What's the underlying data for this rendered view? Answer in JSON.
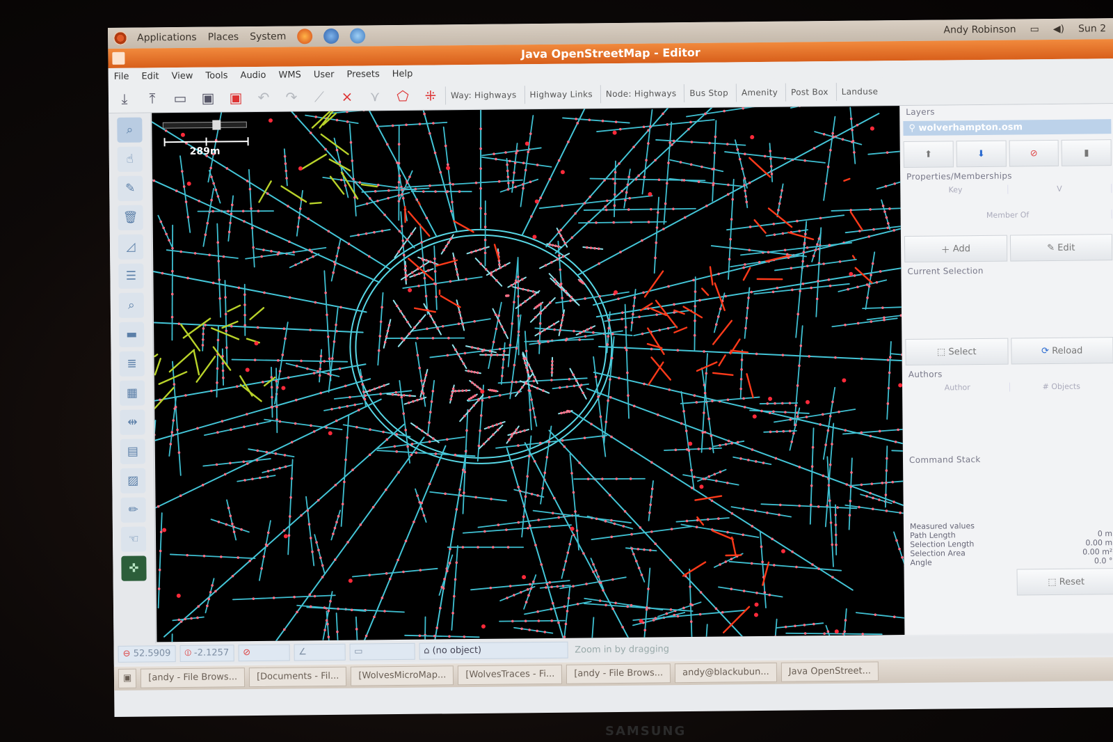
{
  "system_panel": {
    "menus": [
      "Applications",
      "Places",
      "System"
    ],
    "user": "Andy Robinson",
    "clock": "Sun 2"
  },
  "window": {
    "title": "Java OpenStreetMap - Editor"
  },
  "menubar": [
    "File",
    "Edit",
    "View",
    "Tools",
    "Audio",
    "WMS",
    "User",
    "Presets",
    "Help"
  ],
  "toolbar": {
    "presets": [
      "Way: Highways",
      "Highway Links",
      "Node: Highways",
      "Bus Stop",
      "Amenity",
      "Post Box",
      "Landuse"
    ]
  },
  "map": {
    "scale_label": "289m"
  },
  "side_panel": {
    "layers_title": "Layers",
    "layer_name": "wolverhampton.osm",
    "properties_title": "Properties/Memberships",
    "col_key": "Key",
    "col_value": "V",
    "member_of": "Member Of",
    "add_label": "Add",
    "edit_label": "Edit",
    "current_selection_title": "Current Selection",
    "select_label": "Select",
    "reload_label": "Reload",
    "authors_title": "Authors",
    "col_author": "Author",
    "col_objects": "# Objects",
    "command_stack_title": "Command Stack",
    "measured": {
      "title": "Measured values",
      "rows": [
        {
          "label": "Path Length",
          "value": "0 m"
        },
        {
          "label": "Selection Length",
          "value": "0.00 m"
        },
        {
          "label": "Selection Area",
          "value": "0.00 m²"
        },
        {
          "label": "Angle",
          "value": "0.0 °"
        }
      ],
      "reset_label": "Reset"
    }
  },
  "statusbar": {
    "lat": "52.5909",
    "lon": "-2.1257",
    "object": "(no object)",
    "help": "Zoom in by dragging"
  },
  "taskbar": {
    "items": [
      "[andy - File Brows...",
      "[Documents - Fil...",
      "[WolvesMicroMap...",
      "[WolvesTraces - Fi...",
      "[andy - File Brows...",
      "andy@blackubun...",
      "Java OpenStreet..."
    ]
  },
  "monitor_brand": "SAMSUNG"
}
